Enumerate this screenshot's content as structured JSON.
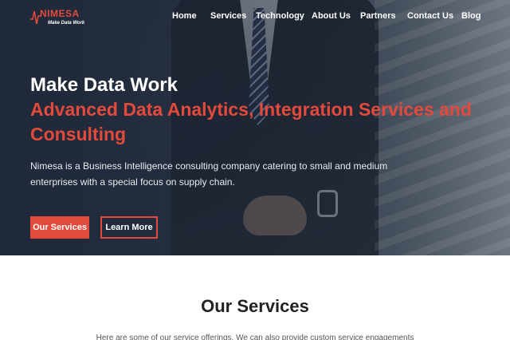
{
  "brand": {
    "name": "NIMESA",
    "tagline": "Make Data Work",
    "accent_color": "#e24a3c"
  },
  "nav": {
    "items": [
      {
        "label": "Home"
      },
      {
        "label": "Services"
      },
      {
        "label": "Technology"
      },
      {
        "label": "About Us"
      },
      {
        "label": "Partners"
      },
      {
        "label": "Contact Us"
      },
      {
        "label": "Blog"
      }
    ]
  },
  "hero": {
    "heading": "Make Data Work",
    "subheading": "Advanced Data Analytics, Integration Services and Consulting",
    "description": "Nimesa is a Business Intelligence consulting company catering to small and medium enterprises with a special focus on supply chain.",
    "primary_button": "Our Services",
    "secondary_button": "Learn More"
  },
  "services": {
    "title": "Our Services",
    "intro": "Here are some of our service offerings. We can also provide custom service engagements"
  }
}
